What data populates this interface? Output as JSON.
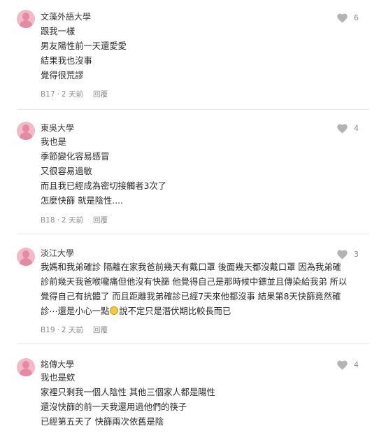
{
  "comments": [
    {
      "school": "文藻外語大學",
      "likes": "6",
      "lines": [
        "跟我一樣",
        "男友陽性前一天還愛愛",
        "結果我也沒事",
        "覺得很荒謬"
      ],
      "floor": "B17",
      "time": "2 天前",
      "reply": "回覆"
    },
    {
      "school": "東吳大學",
      "likes": "4",
      "lines": [
        "我也是",
        "季節變化容易感冒",
        "又很容易過敏",
        "而且我已經成為密切接觸者3次了",
        "怎麼快篩 就是陰性...."
      ],
      "floor": "B18",
      "time": "2 天前",
      "reply": "回覆"
    },
    {
      "school": "淡江大學",
      "likes": "3",
      "lines": [
        "我媽和我弟確診 隔離在家我爸前幾天有戴口罩 後面幾天都沒戴口罩 因為我弟確",
        "診前幾天我爸喉嚨痛但他沒有快篩 他覺得自己是那時候中鏢並且傳染給我弟 所以",
        "覺得自己有抗體了 而且距離我弟確診已經7天來他都沒事 結果第8天快篩竟然確",
        "診⋯還是小心一點",
        "說不定只是潛伏期比較長而已"
      ],
      "floor": "B19",
      "time": "2 天前",
      "reply": "回覆"
    },
    {
      "school": "銘傳大學",
      "likes": "4",
      "lines": [
        "我也是欸",
        "家裡只剩我一個人陰性 其他三個家人都是陽性",
        "還沒快篩的前一天我還用過他們的筷子",
        "已經第五天了 快篩兩次依舊是陰"
      ],
      "floor": "",
      "time": "",
      "reply": ""
    }
  ],
  "colors": {
    "avatar_bg": "#f2b9c7",
    "avatar_fg": "#e58aa2",
    "heart": "#b3b3b3"
  }
}
